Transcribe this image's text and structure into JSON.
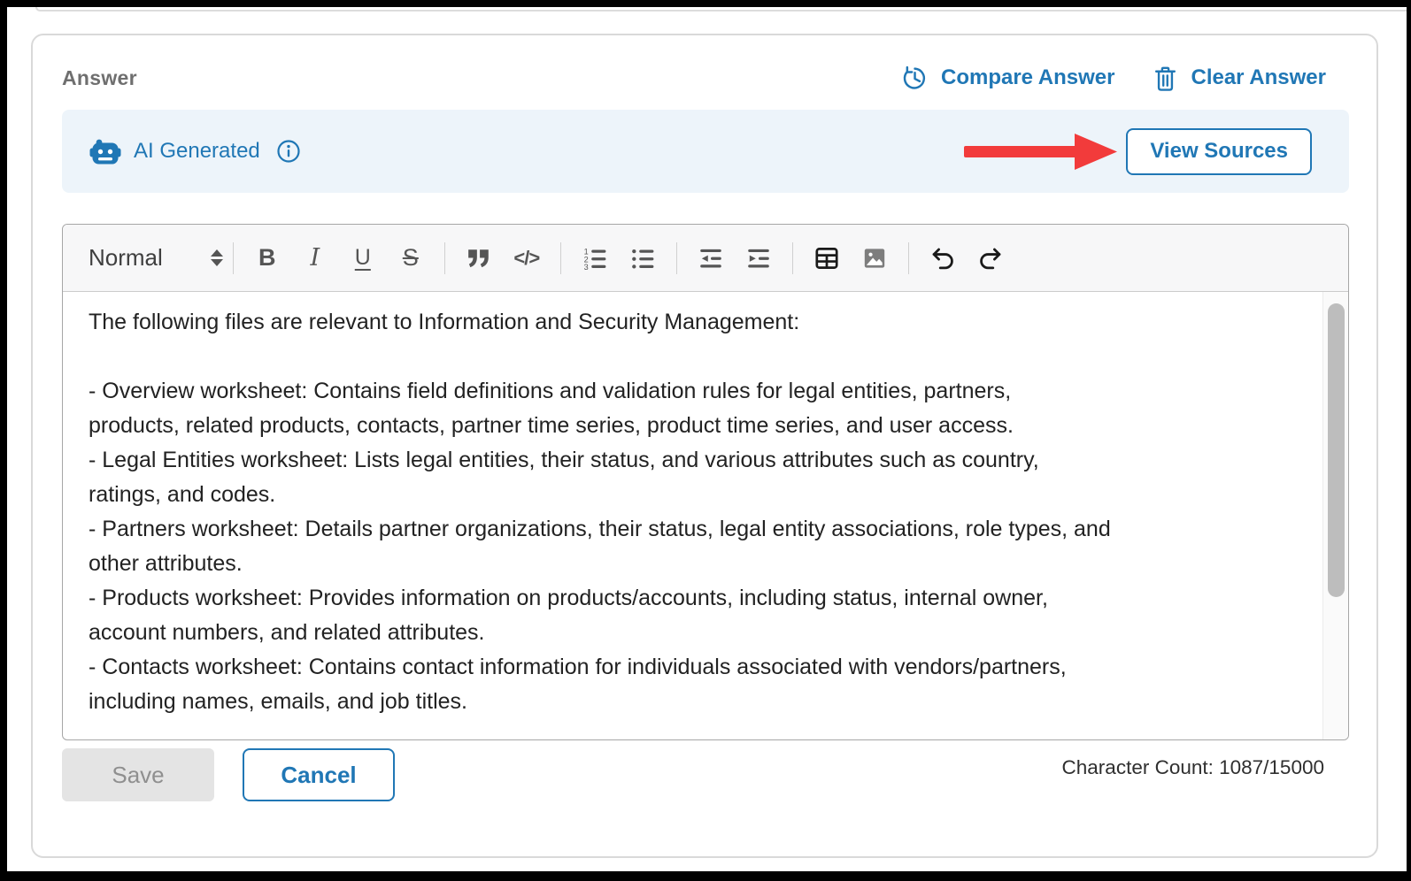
{
  "header": {
    "title": "Answer",
    "compare_label": "Compare Answer",
    "clear_label": "Clear Answer"
  },
  "banner": {
    "ai_label": "AI Generated",
    "view_sources_label": "View Sources"
  },
  "toolbar": {
    "paragraph_style": "Normal",
    "bold": "B",
    "italic": "I",
    "underline": "U",
    "strikethrough": "S",
    "code": "</>"
  },
  "editor": {
    "lines": [
      "The following files are relevant to Information and Security Management:",
      "",
      "- Overview worksheet: Contains field definitions and validation rules for legal entities, partners,",
      "products, related products, contacts, partner time series, product time series, and user access.",
      "- Legal Entities worksheet: Lists legal entities, their status, and various attributes such as country,",
      "ratings, and codes.",
      "- Partners worksheet: Details partner organizations, their status, legal entity associations, role types, and",
      "other attributes.",
      "- Products worksheet: Provides information on products/accounts, including status, internal owner,",
      "account numbers, and related attributes.",
      "- Contacts worksheet: Contains contact information for individuals associated with vendors/partners,",
      "including names, emails, and job titles."
    ]
  },
  "footer": {
    "save_label": "Save",
    "cancel_label": "Cancel",
    "character_count": "Character Count: 1087/15000"
  },
  "colors": {
    "accent_blue": "#2077b5",
    "arrow_red": "#f23b3b",
    "banner_bg": "#edf4fa",
    "save_disabled_bg": "#e4e4e4"
  }
}
